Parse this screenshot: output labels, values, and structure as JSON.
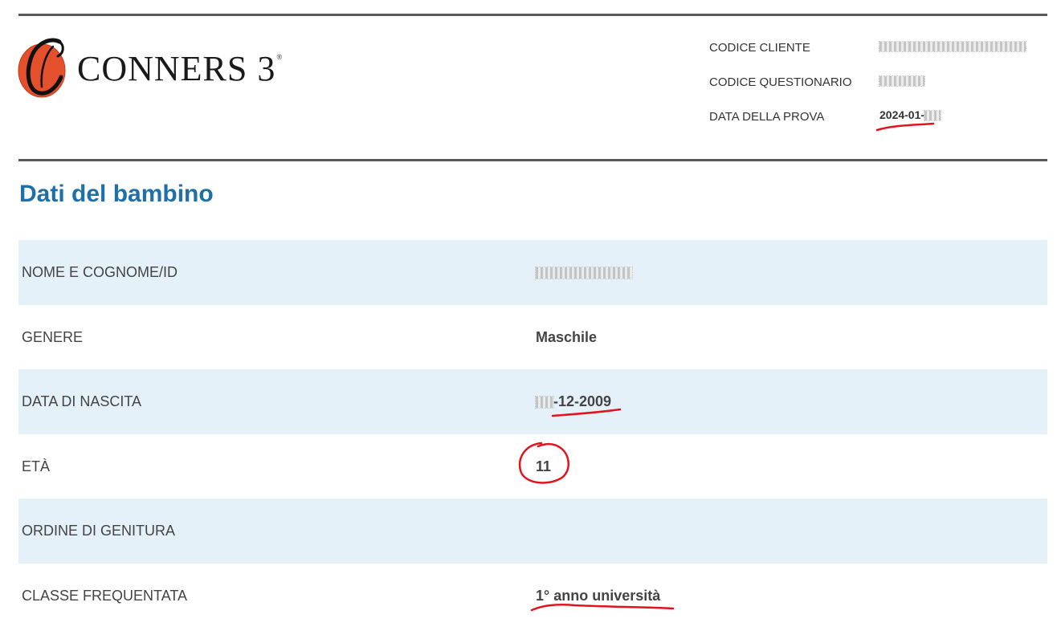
{
  "header": {
    "brand": "CONNERS 3",
    "brand_mark": "®",
    "meta": [
      {
        "label": "CODICE CLIENTE",
        "value": ""
      },
      {
        "label": "CODICE QUESTIONARIO",
        "value": ""
      },
      {
        "label": "DATA DELLA PROVA",
        "value": "2024-01-"
      }
    ]
  },
  "section": {
    "title": "Dati del bambino"
  },
  "rows": [
    {
      "label": "NOME E COGNOME/ID",
      "value": ""
    },
    {
      "label": "GENERE",
      "value": "Maschile"
    },
    {
      "label": "DATA DI NASCITA",
      "value": "-12-2009"
    },
    {
      "label": "ETÀ",
      "value": "11"
    },
    {
      "label": "ORDINE DI GENITURA",
      "value": ""
    },
    {
      "label": "CLASSE FREQUENTATA",
      "value": "1° anno università"
    }
  ],
  "colors": {
    "title": "#1f6fa8",
    "shaded_row": "#e5f1f8",
    "rule": "#5a5a5a",
    "annotation": "#e0141e"
  }
}
